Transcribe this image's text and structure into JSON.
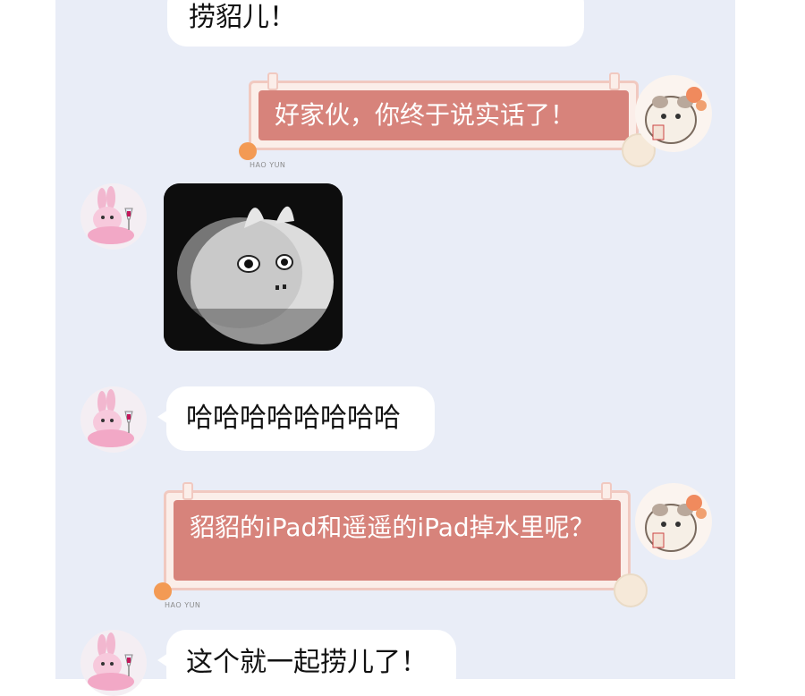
{
  "messages": [
    {
      "id": "m1",
      "side": "left",
      "text": "捞貂儿！"
    },
    {
      "id": "m2",
      "side": "right",
      "text": "好家伙，你终于说实话了！"
    },
    {
      "id": "m3",
      "side": "left",
      "type": "sticker"
    },
    {
      "id": "m4",
      "side": "left",
      "text": "哈哈哈哈哈哈哈哈"
    },
    {
      "id": "m5",
      "side": "right",
      "text": "貂貂的iPad和遥遥的iPad掉水里呢？"
    },
    {
      "id": "m6",
      "side": "left",
      "text": "这个就一起捞儿了！"
    }
  ],
  "bubble_brand": "HAO YUN",
  "colors": {
    "chat_background": "#e9edf7",
    "right_bubble": "#d7837b",
    "left_bubble": "#ffffff"
  }
}
